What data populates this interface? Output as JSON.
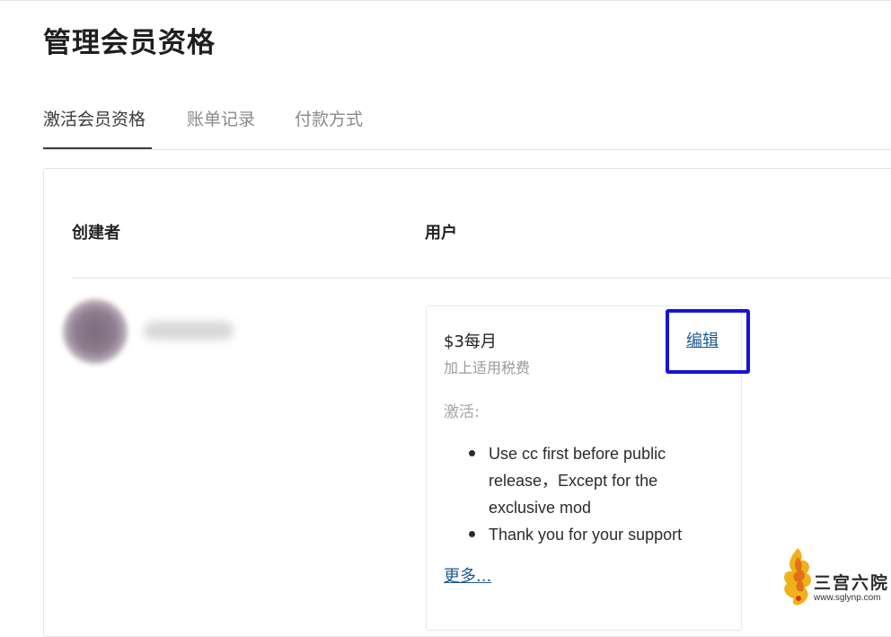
{
  "page": {
    "title": "管理会员资格"
  },
  "tabs": [
    {
      "label": "激活会员资格",
      "active": true
    },
    {
      "label": "账单记录",
      "active": false
    },
    {
      "label": "付款方式",
      "active": false
    }
  ],
  "table": {
    "columns": {
      "creator": "创建者",
      "user": "用户"
    },
    "row": {
      "creator_name": "",
      "tier": {
        "price": "$3每月",
        "tax_note": "加上适用税费",
        "edit_label": "编辑",
        "active_label": "激活:",
        "benefits": [
          "Use cc first before public release，Except for the exclusive mod",
          "Thank you for your support"
        ],
        "more_label": "更多..."
      }
    }
  },
  "colors": {
    "highlight_box": "#1515d6",
    "link": "#1d5b8f",
    "muted_text": "#9a9a9a"
  },
  "watermark": {
    "title": "三宫六院",
    "url": "www.sglynp.com",
    "icon": "phoenix-flame-icon"
  }
}
